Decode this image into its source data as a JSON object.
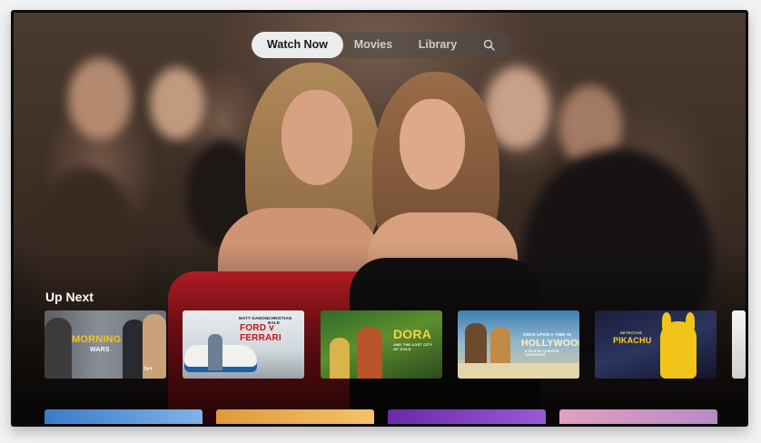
{
  "nav": {
    "tabs": [
      {
        "label": "Watch Now",
        "selected": true
      },
      {
        "label": "Movies",
        "selected": false
      },
      {
        "label": "Library",
        "selected": false
      }
    ],
    "search_icon": "search-icon"
  },
  "up_next": {
    "heading": "Up Next",
    "items": [
      {
        "title": "MORNING",
        "subtitle": "WARS",
        "badge": "tv+"
      },
      {
        "credit_1": "MATT DAMON",
        "credit_2": "CHRISTIAN BALE",
        "title": "FORD v FERRARI"
      },
      {
        "title": "DORA",
        "subtitle": "AND THE LOST CITY OF GOLD"
      },
      {
        "tagline": "ONCE UPON A TIME IN",
        "title": "HOLLYWOOD",
        "credit": "A FILM BY QUENTIN TARANTINO"
      },
      {
        "title": "PIKACHU",
        "pre": "DETECTIVE"
      }
    ]
  },
  "colors": {
    "nav_active_bg": "#ececec",
    "accent_red": "#d2202a"
  }
}
